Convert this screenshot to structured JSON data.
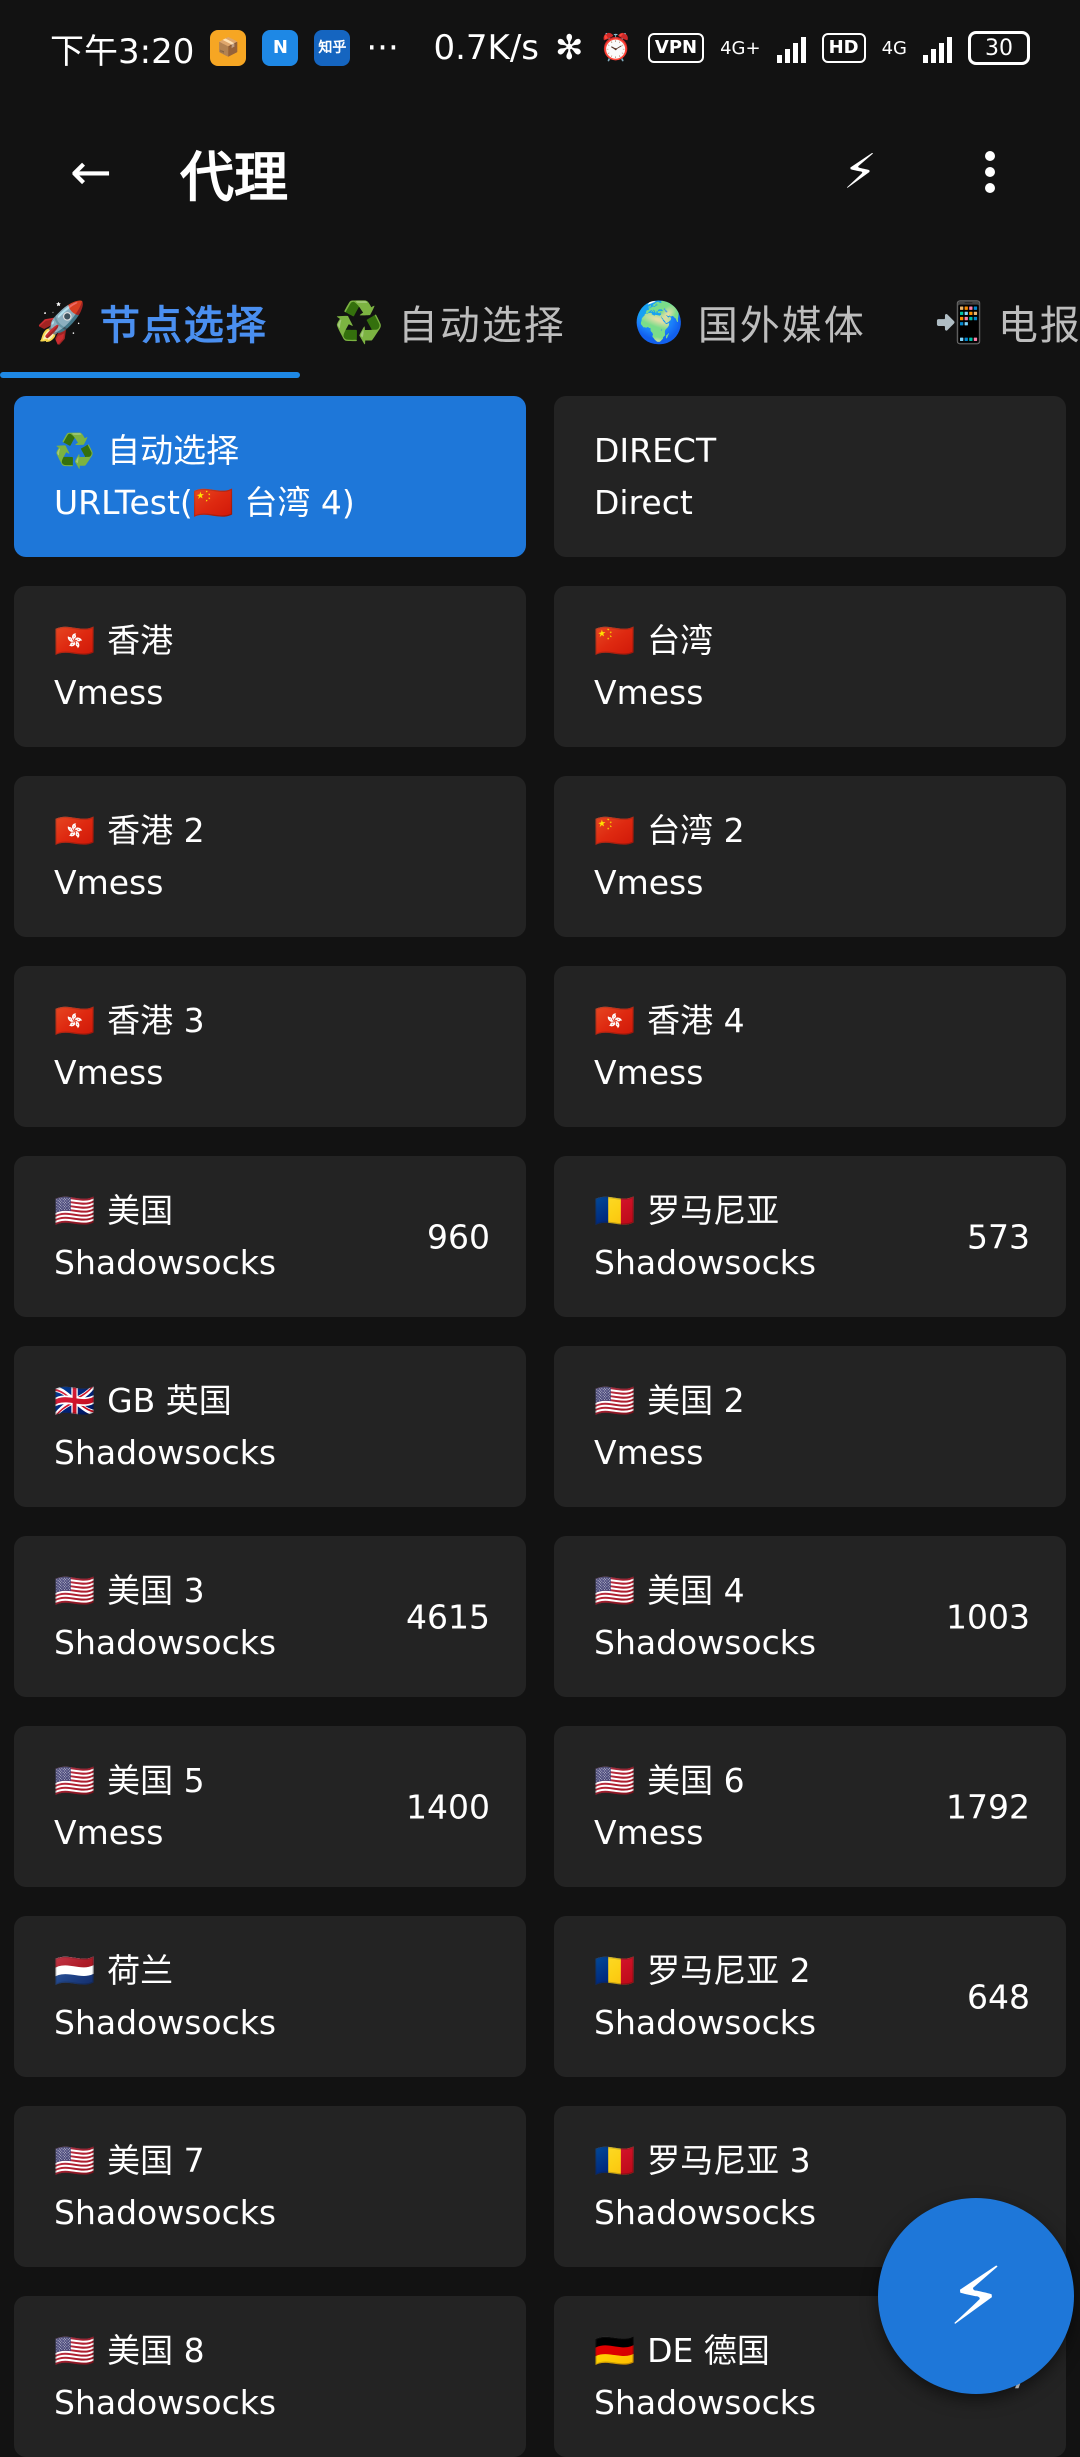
{
  "status_bar": {
    "time": "下午3:20",
    "noti_icons": [
      "📦",
      "N",
      "知乎"
    ],
    "more": "···",
    "net_speed": "0.7K/s",
    "bluetooth_icon": "✻",
    "alarm_icon": "⏰",
    "vpn": "VPN",
    "net1": "4G+",
    "hd": "HD",
    "net2": "4G",
    "battery": "30"
  },
  "appbar": {
    "back_icon": "←",
    "title": "代理",
    "bolt_icon": "⚡"
  },
  "tabs": [
    {
      "icon": "🚀",
      "label": "节点选择"
    },
    {
      "icon": "♻️",
      "label": "自动选择"
    },
    {
      "icon": "🌍",
      "label": "国外媒体"
    },
    {
      "icon": "📲",
      "label": "电报"
    }
  ],
  "proxies": [
    {
      "flag": "♻️",
      "name": "自动选择",
      "type": "URLTest(🇨🇳 台湾 4)",
      "delay": ""
    },
    {
      "flag": "",
      "name": "DIRECT",
      "type": "Direct",
      "delay": ""
    },
    {
      "flag": "🇭🇰",
      "name": "香港",
      "type": "Vmess",
      "delay": ""
    },
    {
      "flag": "🇨🇳",
      "name": "台湾",
      "type": "Vmess",
      "delay": ""
    },
    {
      "flag": "🇭🇰",
      "name": "香港 2",
      "type": "Vmess",
      "delay": ""
    },
    {
      "flag": "🇨🇳",
      "name": "台湾 2",
      "type": "Vmess",
      "delay": ""
    },
    {
      "flag": "🇭🇰",
      "name": "香港 3",
      "type": "Vmess",
      "delay": ""
    },
    {
      "flag": "🇭🇰",
      "name": "香港 4",
      "type": "Vmess",
      "delay": ""
    },
    {
      "flag": "🇺🇸",
      "name": "美国",
      "type": "Shadowsocks",
      "delay": "960"
    },
    {
      "flag": "🇷🇴",
      "name": "罗马尼亚",
      "type": "Shadowsocks",
      "delay": "573"
    },
    {
      "flag": "🇬🇧",
      "name": "GB 英国",
      "type": "Shadowsocks",
      "delay": ""
    },
    {
      "flag": "🇺🇸",
      "name": "美国 2",
      "type": "Vmess",
      "delay": ""
    },
    {
      "flag": "🇺🇸",
      "name": "美国 3",
      "type": "Shadowsocks",
      "delay": "4615"
    },
    {
      "flag": "🇺🇸",
      "name": "美国 4",
      "type": "Shadowsocks",
      "delay": "1003"
    },
    {
      "flag": "🇺🇸",
      "name": "美国 5",
      "type": "Vmess",
      "delay": "1400"
    },
    {
      "flag": "🇺🇸",
      "name": "美国 6",
      "type": "Vmess",
      "delay": "1792"
    },
    {
      "flag": "🇳🇱",
      "name": "荷兰",
      "type": "Shadowsocks",
      "delay": ""
    },
    {
      "flag": "🇷🇴",
      "name": "罗马尼亚 2",
      "type": "Shadowsocks",
      "delay": "648"
    },
    {
      "flag": "🇺🇸",
      "name": "美国 7",
      "type": "Shadowsocks",
      "delay": ""
    },
    {
      "flag": "🇷🇴",
      "name": "罗马尼亚 3",
      "type": "Shadowsocks",
      "delay": ""
    },
    {
      "flag": "🇺🇸",
      "name": "美国 8",
      "type": "Shadowsocks",
      "delay": ""
    },
    {
      "flag": "🇩🇪",
      "name": "DE 德国",
      "type": "Shadowsocks",
      "delay": "777"
    }
  ],
  "selected_index": 0,
  "fab_icon": "⚡",
  "colors": {
    "accent": "#1e77d9",
    "card": "#232323",
    "background": "#121212",
    "tab_active": "#4a8ff0"
  }
}
